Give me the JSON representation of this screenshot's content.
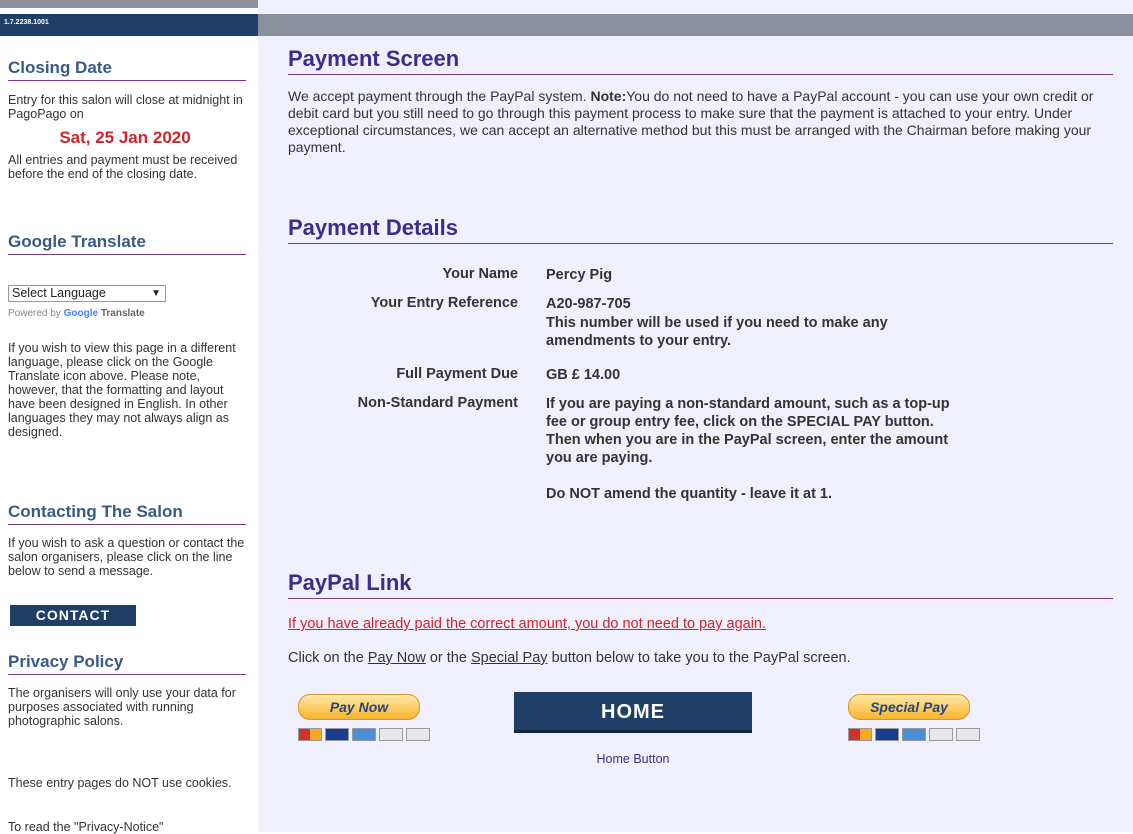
{
  "sidebar": {
    "version": "1.7.2238.1001",
    "closing": {
      "heading": "Closing Date",
      "intro": "Entry for this salon will close at midnight in PagoPago on",
      "date": "Sat, 25 Jan 2020",
      "note": "All entries and payment must be received before the end of the closing date."
    },
    "translate": {
      "heading": "Google Translate",
      "select_value": "Select Language",
      "powered_prefix": "Powered by",
      "powered_google": "Google",
      "powered_translate": "Translate",
      "note": "If you wish to view this page in a different language, please click on the Google Translate icon above. Please note, however, that the formatting and layout have been designed in English. In other languages they may not always align as designed."
    },
    "contact": {
      "heading": "Contacting The Salon",
      "note": "If you wish to ask a question or contact the salon organisers, please click on the line below to send a message.",
      "button": "CONTACT"
    },
    "privacy": {
      "heading": "Privacy Policy",
      "p1": "The organisers will only use your data for purposes associated with running photographic salons.",
      "p2": "These entry pages do NOT use cookies.",
      "p3": "To read the \"Privacy-Notice\""
    }
  },
  "main": {
    "payment_screen": {
      "heading": "Payment Screen",
      "text_before": "We accept payment through the PayPal system. ",
      "note_label": "Note:",
      "text_after": "You do not need to have a PayPal account - you can use your own credit or debit card but you still need to go through this payment process to make sure that the payment is attached to your entry. Under exceptional circumstances, we can accept an alternative method but this must be arranged with the Chairman before making your payment."
    },
    "payment_details": {
      "heading": "Payment Details",
      "your_name_label": "Your Name",
      "your_name": "Percy Pig",
      "ref_label": "Your Entry Reference",
      "ref_value": "A20-987-705",
      "ref_note": "This number will be used if you need to make any amendments to your entry.",
      "due_label": "Full Payment Due",
      "due_value": "GB £ 14.00",
      "nonstd_label": "Non-Standard Payment",
      "nonstd_text": "If you are paying a non-standard amount, such as a top-up fee or group entry fee, click on the SPECIAL PAY button. Then when you are in the PayPal screen, enter the amount you are paying.",
      "nonstd_text2": "Do NOT amend the quantity - leave it at 1."
    },
    "paypal": {
      "heading": "PayPal Link",
      "paid_note": "If you have already paid the correct amount, you do not need to pay again.",
      "click_prefix": "Click on the ",
      "click_paynow": "Pay Now",
      "click_mid": " or the ",
      "click_special": "Special Pay",
      "click_suffix": "  button below to take you to the PayPal screen.",
      "paynow_button": "Pay Now",
      "special_button": "Special Pay",
      "home_button": "HOME",
      "home_caption": "Home Button"
    }
  }
}
